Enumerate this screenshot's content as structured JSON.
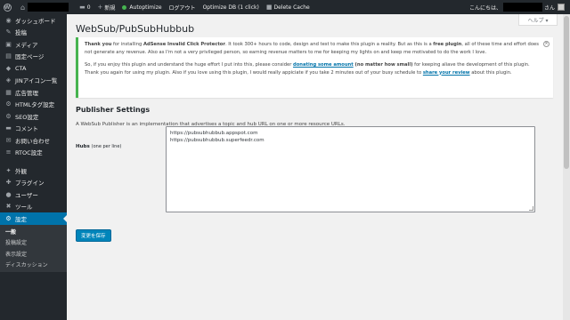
{
  "adminbar": {
    "comments_count": "0",
    "new_label": "新規",
    "autoptimize_label": "Autoptimize",
    "logout_label": "ログアウト",
    "optimize_db_label": "Optimize DB (1 click)",
    "delete_cache_label": "Delete Cache",
    "greeting": "こんにちは、",
    "greeting_suffix": "さん"
  },
  "sidebar": {
    "items": [
      {
        "icon": "dashboard-icon",
        "glyph": "◉",
        "label": "ダッシュボード"
      },
      {
        "icon": "pin-icon",
        "glyph": "✎",
        "label": "投稿"
      },
      {
        "icon": "media-icon",
        "glyph": "▣",
        "label": "メディア"
      },
      {
        "icon": "page-icon",
        "glyph": "▤",
        "label": "固定ページ"
      },
      {
        "icon": "cta-icon",
        "glyph": "◆",
        "label": "CTA"
      },
      {
        "icon": "jin-icon",
        "glyph": "◈",
        "label": "JINアイコン一覧"
      },
      {
        "icon": "ads-icon",
        "glyph": "▦",
        "label": "広告管理"
      },
      {
        "icon": "html-tag-icon",
        "glyph": "⚙",
        "label": "HTMLタグ設定"
      },
      {
        "icon": "seo-icon",
        "glyph": "⚙",
        "label": "SEO設定"
      },
      {
        "icon": "comment-icon",
        "glyph": "▬",
        "label": "コメント"
      },
      {
        "icon": "mail-icon",
        "glyph": "✉",
        "label": "お問い合わせ"
      },
      {
        "icon": "rtoc-icon",
        "glyph": "≡",
        "label": "RTOC設定"
      },
      {
        "icon": "appearance-icon",
        "glyph": "✦",
        "label": "外観"
      },
      {
        "icon": "plugin-icon",
        "glyph": "✚",
        "label": "プラグイン"
      },
      {
        "icon": "user-icon",
        "glyph": "●",
        "label": "ユーザー"
      },
      {
        "icon": "tools-icon",
        "glyph": "✖",
        "label": "ツール"
      },
      {
        "icon": "settings-icon",
        "glyph": "⚙",
        "label": "設定"
      }
    ],
    "submenu": [
      "一般",
      "投稿設定",
      "表示設定",
      "ディスカッション"
    ]
  },
  "help_label": "ヘルプ ▾",
  "page_title": "WebSub/PubSubHubbub",
  "notice": {
    "p1_thank": "Thank you",
    "p1_a": " for installing ",
    "p1_plugin": "AdSense Invalid Click Protector",
    "p1_b": ". It took 300+ hours to code, design and test to make this plugin a reality. But as this is a ",
    "p1_free": "free plugin",
    "p1_c": ", all of these time and effort does not generate any revenue. Also as I'm not a very privileged person, so earning revenue matters to me for keeping my lights on and keep me motivated to do the work I love.",
    "p2_a": "So, if you enjoy this plugin and understand the huge effort I put into this, please consider ",
    "p2_link": "donating some amount",
    "p2_b": " (no matter how small)",
    "p2_c": " for keeping aliave the development of this plugin. Thank you again for using my plugin. Also if you love using this plugin, I would really appiciate if you take 2 minutes out of your busy schedule to ",
    "p2_review": "share your review",
    "p2_d": " about this plugin."
  },
  "settings": {
    "section_title": "Publisher Settings",
    "description": "A WebSub Publisher is an implementation that advertises a topic and hub URL on one or more resource URLs.",
    "hubs_label": "Hubs",
    "hubs_hint": "(one per line)",
    "hubs_lines": [
      "https://pubsubhubbub.appspot.com",
      "https://pubsubhubbub.superfeedr.com"
    ]
  },
  "save_label": "変更を保存"
}
